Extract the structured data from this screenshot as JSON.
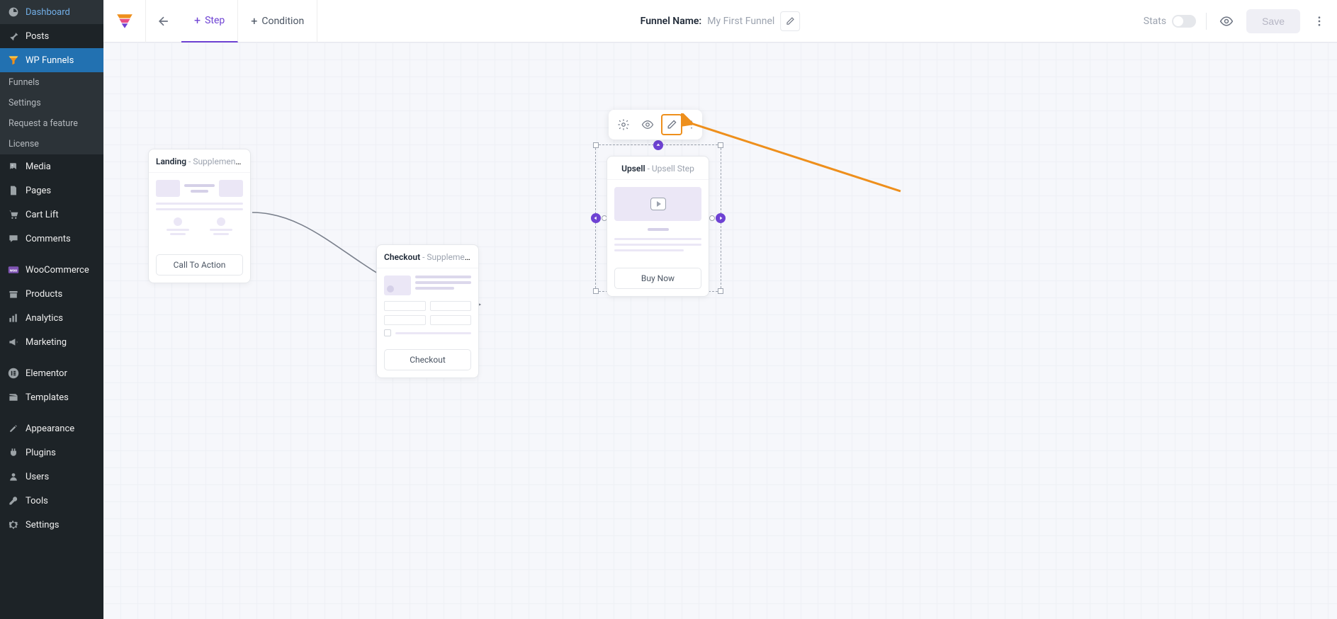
{
  "sidebar": {
    "items": [
      {
        "icon": "dashboard",
        "label": "Dashboard"
      },
      {
        "icon": "pin",
        "label": "Posts"
      },
      {
        "icon": "funnel",
        "label": "WP Funnels",
        "active": true,
        "sub": [
          "Funnels",
          "Settings",
          "Request a feature",
          "License"
        ]
      },
      {
        "icon": "media",
        "label": "Media"
      },
      {
        "icon": "page",
        "label": "Pages"
      },
      {
        "icon": "cart",
        "label": "Cart Lift"
      },
      {
        "icon": "comment",
        "label": "Comments"
      },
      {
        "icon": "woo",
        "label": "WooCommerce"
      },
      {
        "icon": "products",
        "label": "Products"
      },
      {
        "icon": "analytics",
        "label": "Analytics"
      },
      {
        "icon": "megaphone",
        "label": "Marketing"
      },
      {
        "icon": "elementor",
        "label": "Elementor"
      },
      {
        "icon": "templates",
        "label": "Templates"
      },
      {
        "icon": "appearance",
        "label": "Appearance"
      },
      {
        "icon": "plugins",
        "label": "Plugins"
      },
      {
        "icon": "users",
        "label": "Users"
      },
      {
        "icon": "tools",
        "label": "Tools"
      },
      {
        "icon": "settings",
        "label": "Settings"
      }
    ]
  },
  "topbar": {
    "step_label": "Step",
    "condition_label": "Condition",
    "funnel_name_label": "Funnel Name:",
    "funnel_name_value": "My First Funnel",
    "stats_label": "Stats",
    "save_label": "Save"
  },
  "nodes": {
    "landing": {
      "type": "Landing",
      "sub": " - Supplement La...",
      "cta": "Call To Action"
    },
    "checkout": {
      "type": "Checkout",
      "sub": " - Supplement C...",
      "cta": "Checkout"
    },
    "upsell": {
      "type": "Upsell",
      "sub": " - Upsell Step",
      "cta": "Buy Now"
    }
  },
  "colors": {
    "accent": "#6e42d3",
    "highlight": "#ee8f1c"
  }
}
